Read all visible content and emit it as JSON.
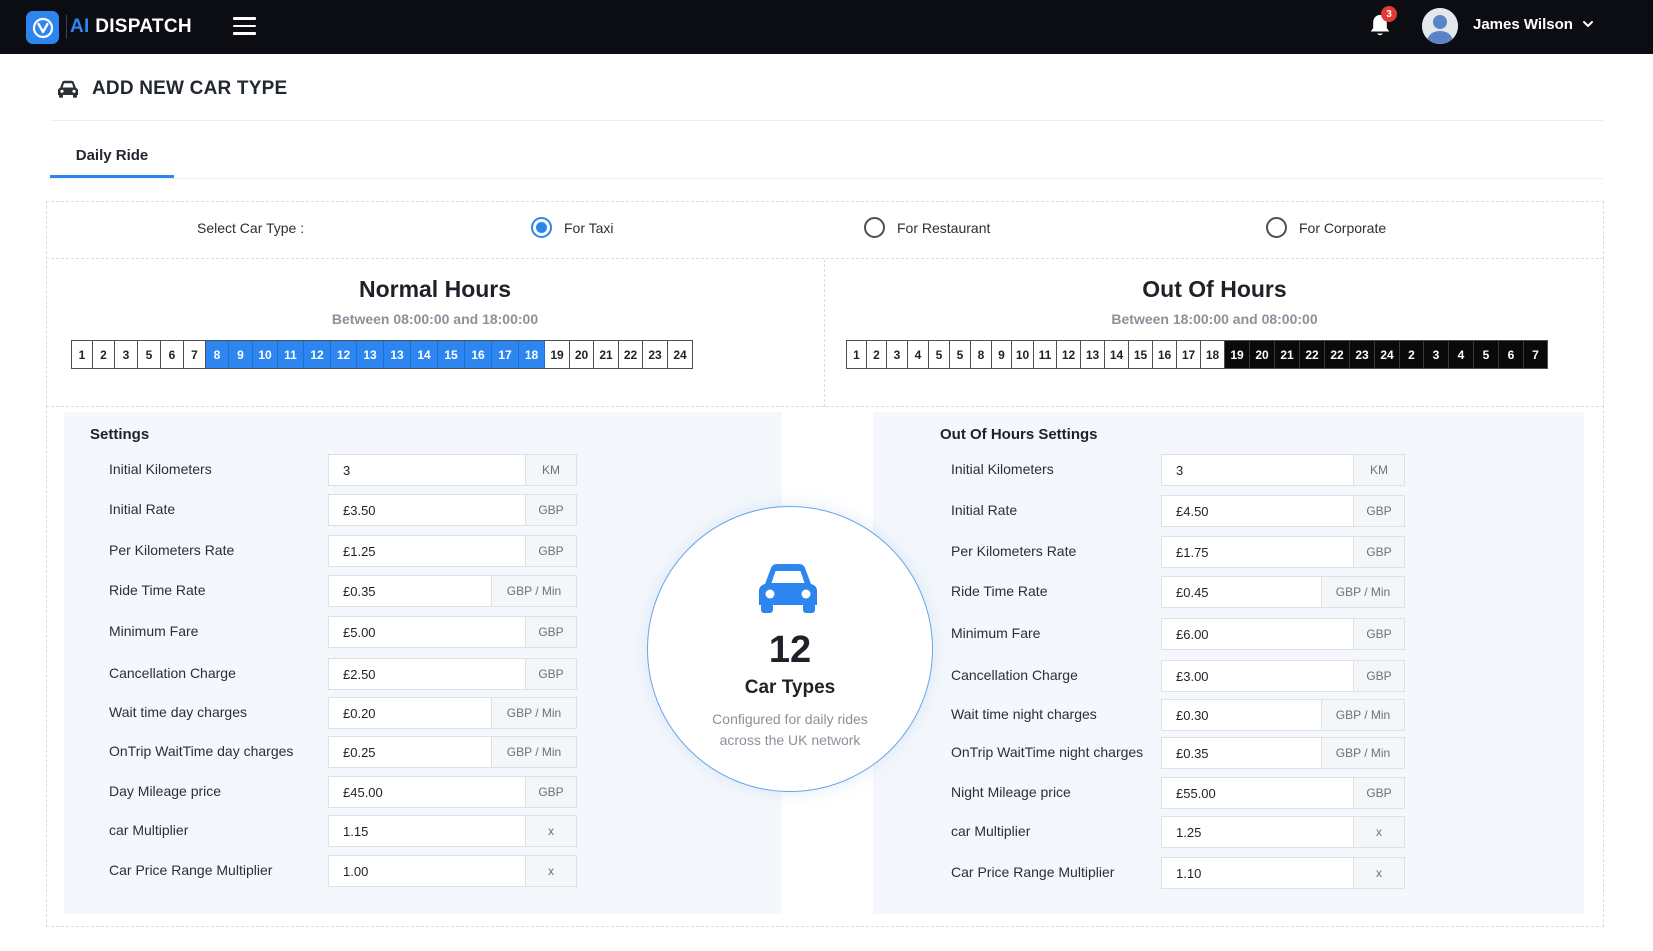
{
  "header": {
    "brand_ai": "AI",
    "brand_rest": " DISPATCH",
    "notifications_count": "3",
    "user_name": "James Wilson"
  },
  "page": {
    "title": "ADD NEW CAR TYPE",
    "tabs": [
      {
        "label": "Daily Ride",
        "active": true
      }
    ]
  },
  "car_type": {
    "label": "Select Car Type :",
    "options": [
      {
        "label": "For Taxi",
        "selected": true
      },
      {
        "label": "For Restaurant",
        "selected": false
      },
      {
        "label": "For Corporate",
        "selected": false
      }
    ]
  },
  "normal_hours": {
    "title": "Normal Hours",
    "subtitle": "Between 08:00:00 and 18:00:00",
    "hours": [
      {
        "label": "1",
        "on": false
      },
      {
        "label": "2",
        "on": false
      },
      {
        "label": "3",
        "on": false
      },
      {
        "label": "5",
        "on": false
      },
      {
        "label": "6",
        "on": false
      },
      {
        "label": "7",
        "on": false
      },
      {
        "label": "8",
        "on": true
      },
      {
        "label": "9",
        "on": true
      },
      {
        "label": "10",
        "on": true
      },
      {
        "label": "11",
        "on": true
      },
      {
        "label": "12",
        "on": true
      },
      {
        "label": "12",
        "on": true
      },
      {
        "label": "13",
        "on": true
      },
      {
        "label": "13",
        "on": true
      },
      {
        "label": "14",
        "on": true
      },
      {
        "label": "15",
        "on": true
      },
      {
        "label": "16",
        "on": true
      },
      {
        "label": "17",
        "on": true
      },
      {
        "label": "18",
        "on": true
      },
      {
        "label": "19",
        "on": false
      },
      {
        "label": "20",
        "on": false
      },
      {
        "label": "21",
        "on": false
      },
      {
        "label": "22",
        "on": false
      },
      {
        "label": "23",
        "on": false
      },
      {
        "label": "24",
        "on": false
      }
    ]
  },
  "out_hours": {
    "title": "Out Of Hours",
    "subtitle": "Between 18:00:00 and 08:00:00",
    "hours": [
      {
        "label": "1",
        "on": false
      },
      {
        "label": "2",
        "on": false
      },
      {
        "label": "3",
        "on": false
      },
      {
        "label": "4",
        "on": false
      },
      {
        "label": "5",
        "on": false
      },
      {
        "label": "5",
        "on": false
      },
      {
        "label": "8",
        "on": false
      },
      {
        "label": "9",
        "on": false
      },
      {
        "label": "10",
        "on": false
      },
      {
        "label": "11",
        "on": false
      },
      {
        "label": "12",
        "on": false
      },
      {
        "label": "13",
        "on": false
      },
      {
        "label": "14",
        "on": false
      },
      {
        "label": "15",
        "on": false
      },
      {
        "label": "16",
        "on": false
      },
      {
        "label": "17",
        "on": false
      },
      {
        "label": "18",
        "on": false
      },
      {
        "label": "19",
        "on": true
      },
      {
        "label": "20",
        "on": true
      },
      {
        "label": "21",
        "on": true
      },
      {
        "label": "22",
        "on": true
      },
      {
        "label": "22",
        "on": true
      },
      {
        "label": "23",
        "on": true
      },
      {
        "label": "24",
        "on": true
      },
      {
        "label": "2",
        "on": true
      },
      {
        "label": "3",
        "on": true
      },
      {
        "label": "4",
        "on": true
      },
      {
        "label": "5",
        "on": true
      },
      {
        "label": "6",
        "on": true
      },
      {
        "label": "7",
        "on": true
      }
    ]
  },
  "settings": {
    "title": "Settings",
    "fields": [
      {
        "label": "Initial Kilometers",
        "value": "3",
        "unit": "KM"
      },
      {
        "label": "Initial Rate",
        "value": "£3.50",
        "unit": "GBP"
      },
      {
        "label": "Per Kilometers Rate",
        "value": "£1.25",
        "unit": "GBP"
      },
      {
        "label": "Ride Time Rate",
        "value": "£0.35",
        "unit": "GBP / Min"
      },
      {
        "label": "Minimum Fare",
        "value": "£5.00",
        "unit": "GBP"
      },
      {
        "label": "Cancellation Charge",
        "value": "£2.50",
        "unit": "GBP"
      },
      {
        "label": "Wait time day charges",
        "value": "£0.20",
        "unit": "GBP / Min"
      },
      {
        "label": "OnTrip WaitTime day charges",
        "value": "£0.25",
        "unit": "GBP / Min"
      },
      {
        "label": "Day Mileage price",
        "value": "£45.00",
        "unit": "GBP"
      },
      {
        "label": "car Multiplier",
        "value": "1.15",
        "unit": "x"
      },
      {
        "label": "Car Price Range Multiplier",
        "value": "1.00",
        "unit": "x"
      }
    ]
  },
  "out_settings": {
    "title": "Out Of Hours Settings",
    "fields": [
      {
        "label": "Initial Kilometers",
        "value": "3",
        "unit": "KM"
      },
      {
        "label": "Initial Rate",
        "value": "£4.50",
        "unit": "GBP"
      },
      {
        "label": "Per Kilometers Rate",
        "value": "£1.75",
        "unit": "GBP"
      },
      {
        "label": "Ride Time Rate",
        "value": "£0.45",
        "unit": "GBP / Min"
      },
      {
        "label": "Minimum Fare",
        "value": "£6.00",
        "unit": "GBP"
      },
      {
        "label": "Cancellation Charge",
        "value": "£3.00",
        "unit": "GBP"
      },
      {
        "label": "Wait time night charges",
        "value": "£0.30",
        "unit": "GBP / Min"
      },
      {
        "label": "OnTrip WaitTime night charges",
        "value": "£0.35",
        "unit": "GBP / Min"
      },
      {
        "label": "Night Mileage price",
        "value": "£55.00",
        "unit": "GBP"
      },
      {
        "label": "car Multiplier",
        "value": "1.25",
        "unit": "x"
      },
      {
        "label": "Car Price Range Multiplier",
        "value": "1.10",
        "unit": "x"
      }
    ]
  },
  "stats": {
    "count": "12",
    "title": "Car Types",
    "description": "Configured for daily rides across the UK network"
  },
  "colors": {
    "accent": "#2d86f0",
    "topbar": "#0b0d12",
    "panel": "#f4f8fc"
  }
}
